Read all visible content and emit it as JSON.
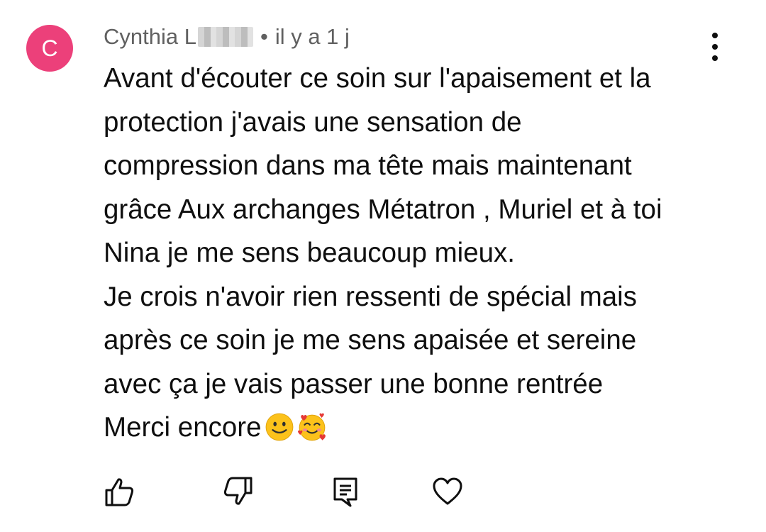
{
  "comment": {
    "avatar_letter": "C",
    "avatar_color": "#ec407a",
    "author": "Cynthia L",
    "separator": "•",
    "timestamp": "il y a 1 j",
    "lines": [
      "Avant d'écouter ce soin sur l'apaisement et la",
      "protection j'avais une sensation de",
      "compression dans ma tête mais maintenant",
      "grâce Aux archanges Métatron , Muriel et à toi",
      "Nina je me sens beaucoup mieux.",
      "Je crois n'avoir rien ressenti de spécial mais",
      "après ce soin je me sens apaisée et sereine",
      "avec ça je vais passer une bonne rentrée",
      "Merci encore"
    ],
    "emojis": [
      "slightly-smiling-face",
      "smiling-face-with-hearts"
    ]
  },
  "actions": {
    "icons": [
      "thumbs-up-icon",
      "thumbs-down-icon",
      "reply-icon",
      "heart-icon"
    ]
  },
  "colors": {
    "meta_text": "#606060",
    "body_text": "#0f0f0f"
  }
}
